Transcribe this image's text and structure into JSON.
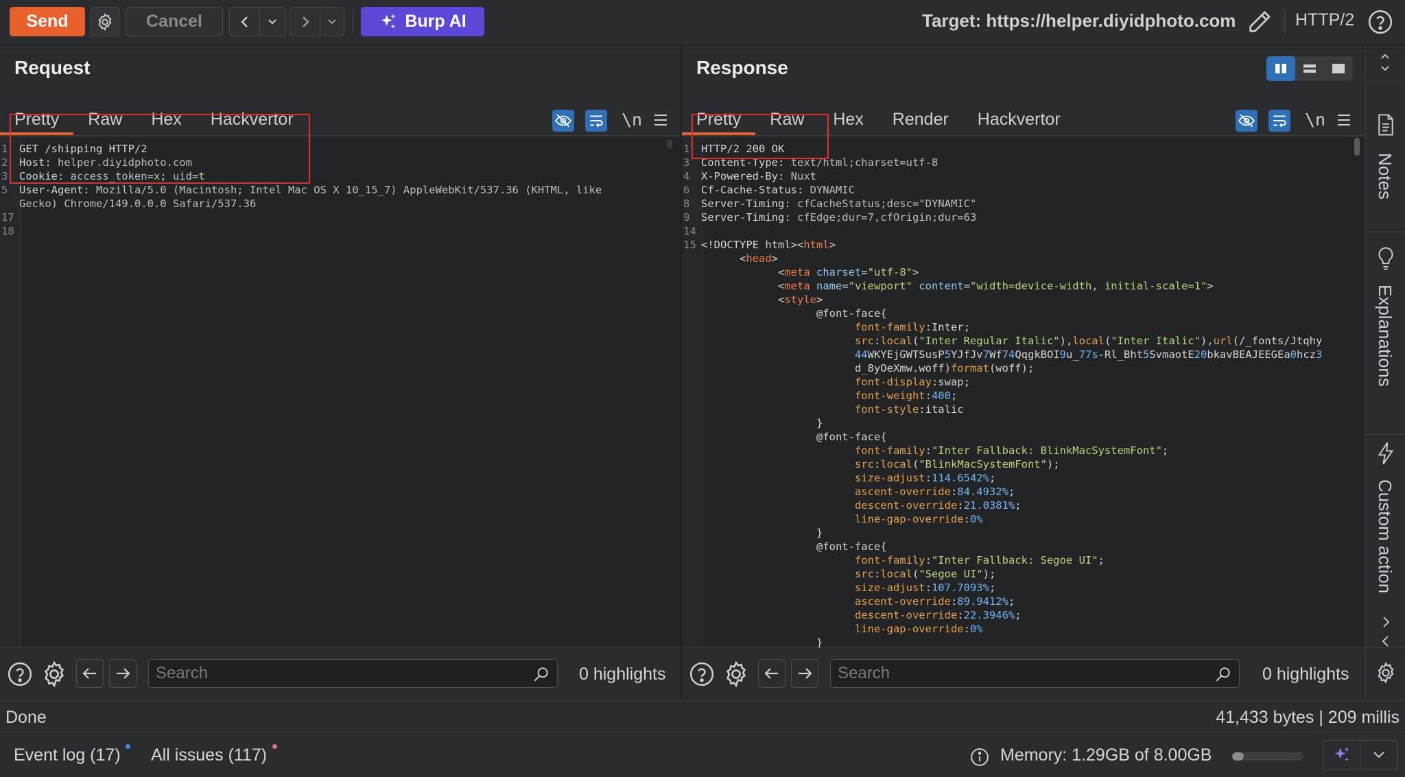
{
  "toolbar": {
    "send_label": "Send",
    "cancel_label": "Cancel",
    "burp_ai_label": "Burp AI",
    "target_label": "Target: https://helper.diyidphoto.com",
    "protocol_label": "HTTP/2"
  },
  "request": {
    "title": "Request",
    "tabs": [
      "Pretty",
      "Raw",
      "Hex",
      "Hackvertor"
    ],
    "newline_toggle": "\\n",
    "lines": [
      {
        "n": "1",
        "parts": [
          [
            "h",
            "GET /shipping HTTP/2"
          ]
        ]
      },
      {
        "n": "2",
        "parts": [
          [
            "h",
            "Host: "
          ],
          [
            "v",
            "helper.diyidphoto.com"
          ]
        ]
      },
      {
        "n": "3",
        "parts": [
          [
            "h",
            "Cookie: "
          ],
          [
            "v",
            "access_token"
          ],
          [
            "h",
            "="
          ],
          [
            "s",
            "x"
          ],
          [
            "h",
            "; "
          ],
          [
            "v",
            "uid"
          ],
          [
            "h",
            "="
          ],
          [
            "s",
            "t"
          ]
        ]
      },
      {
        "n": "5",
        "parts": [
          [
            "h",
            "User-Agent: "
          ],
          [
            "v",
            "Mozilla/5.0 (Macintosh; Intel Mac OS X 10_15_7) AppleWebKit/537.36 (KHTML, like"
          ]
        ]
      },
      {
        "n": "",
        "parts": [
          [
            "v",
            "Gecko) Chrome/149.0.0.0 Safari/537.36"
          ]
        ]
      },
      {
        "n": "17",
        "parts": []
      },
      {
        "n": "18",
        "parts": []
      }
    ],
    "search_placeholder": "Search",
    "highlights": "0 highlights"
  },
  "response": {
    "title": "Response",
    "tabs": [
      "Pretty",
      "Raw",
      "Hex",
      "Render",
      "Hackvertor"
    ],
    "newline_toggle": "\\n",
    "lines": [
      {
        "n": "1",
        "parts": [
          [
            "h",
            "HTTP/2 200 OK"
          ]
        ]
      },
      {
        "n": "3",
        "parts": [
          [
            "h",
            "Content-Type: "
          ],
          [
            "v",
            "text/html;charset=utf-8"
          ]
        ]
      },
      {
        "n": "4",
        "parts": [
          [
            "h",
            "X-Powered-By: "
          ],
          [
            "v",
            "Nuxt"
          ]
        ]
      },
      {
        "n": "6",
        "parts": [
          [
            "h",
            "Cf-Cache-Status: "
          ],
          [
            "v",
            "DYNAMIC"
          ]
        ]
      },
      {
        "n": "8",
        "parts": [
          [
            "h",
            "Server-Timing: "
          ],
          [
            "v",
            "cfCacheStatus;desc=\"DYNAMIC\""
          ]
        ]
      },
      {
        "n": "9",
        "parts": [
          [
            "h",
            "Server-Timing: "
          ],
          [
            "v",
            "cfEdge;dur=7,cfOrigin;dur=63"
          ]
        ]
      },
      {
        "n": "14",
        "parts": []
      },
      {
        "n": "15",
        "parts": [
          [
            "k",
            "<!DOCTYPE html>"
          ],
          [
            "k",
            "<"
          ],
          [
            "t",
            "html"
          ],
          [
            "k",
            ">"
          ]
        ]
      },
      {
        "n": "",
        "parts": [
          [
            "k",
            "      <"
          ],
          [
            "t",
            "head"
          ],
          [
            "k",
            ">"
          ]
        ]
      },
      {
        "n": "",
        "parts": [
          [
            "k",
            "            <"
          ],
          [
            "t",
            "meta"
          ],
          [
            "a",
            " charset"
          ],
          [
            "k",
            "="
          ],
          [
            "s",
            "\"utf-8\""
          ],
          [
            "k",
            ">"
          ]
        ]
      },
      {
        "n": "",
        "parts": [
          [
            "k",
            "            <"
          ],
          [
            "t",
            "meta"
          ],
          [
            "a",
            " name"
          ],
          [
            "k",
            "="
          ],
          [
            "s",
            "\"viewport\""
          ],
          [
            "a",
            " content"
          ],
          [
            "k",
            "="
          ],
          [
            "s",
            "\"width=device-width, initial-scale=1\""
          ],
          [
            "k",
            ">"
          ]
        ]
      },
      {
        "n": "",
        "parts": [
          [
            "k",
            "            <"
          ],
          [
            "t",
            "style"
          ],
          [
            "k",
            ">"
          ]
        ]
      },
      {
        "n": "",
        "parts": [
          [
            "k",
            "                  @font-face{"
          ]
        ]
      },
      {
        "n": "",
        "parts": [
          [
            "p",
            "                        font-family"
          ],
          [
            "k",
            ":Inter;"
          ]
        ]
      },
      {
        "n": "",
        "parts": [
          [
            "p",
            "                        src"
          ],
          [
            "k",
            ":"
          ],
          [
            "p",
            "local"
          ],
          [
            "k",
            "("
          ],
          [
            "s",
            "\"Inter Regular Italic\""
          ],
          [
            "k",
            "),"
          ],
          [
            "p",
            "local"
          ],
          [
            "k",
            "("
          ],
          [
            "s",
            "\"Inter Italic\""
          ],
          [
            "k",
            "),"
          ],
          [
            "p",
            "url"
          ],
          [
            "k",
            "(/_fonts/Jtqhy"
          ]
        ]
      },
      {
        "n": "",
        "parts": [
          [
            "n",
            "                        44"
          ],
          [
            "k",
            "WKYEjGWTSusP"
          ],
          [
            "n",
            "5"
          ],
          [
            "k",
            "YJfJv"
          ],
          [
            "n",
            "7"
          ],
          [
            "k",
            "Wf"
          ],
          [
            "n",
            "74"
          ],
          [
            "k",
            "QqgkBOI"
          ],
          [
            "n",
            "9"
          ],
          [
            "k",
            "u_"
          ],
          [
            "n",
            "77s"
          ],
          [
            "k",
            "-Rl_Bht"
          ],
          [
            "n",
            "5"
          ],
          [
            "k",
            "SvmaotE"
          ],
          [
            "n",
            "20"
          ],
          [
            "k",
            "bkavBEAJEEGEa"
          ],
          [
            "n",
            "0"
          ],
          [
            "k",
            "hcz"
          ],
          [
            "n",
            "3"
          ]
        ]
      },
      {
        "n": "",
        "parts": [
          [
            "k",
            "                        d_8yOeXmw.woff)"
          ],
          [
            "p",
            "format"
          ],
          [
            "k",
            "(woff);"
          ]
        ]
      },
      {
        "n": "",
        "parts": [
          [
            "p",
            "                        font-display"
          ],
          [
            "k",
            ":swap;"
          ]
        ]
      },
      {
        "n": "",
        "parts": [
          [
            "p",
            "                        font-weight"
          ],
          [
            "k",
            ":"
          ],
          [
            "n",
            "400"
          ],
          [
            "k",
            ";"
          ]
        ]
      },
      {
        "n": "",
        "parts": [
          [
            "p",
            "                        font-style"
          ],
          [
            "k",
            ":italic"
          ]
        ]
      },
      {
        "n": "",
        "parts": [
          [
            "k",
            "                  }"
          ]
        ]
      },
      {
        "n": "",
        "parts": [
          [
            "k",
            "                  @font-face{"
          ]
        ]
      },
      {
        "n": "",
        "parts": [
          [
            "p",
            "                        font-family"
          ],
          [
            "k",
            ":"
          ],
          [
            "s",
            "\"Inter Fallback: BlinkMacSystemFont\""
          ],
          [
            "k",
            ";"
          ]
        ]
      },
      {
        "n": "",
        "parts": [
          [
            "p",
            "                        src"
          ],
          [
            "k",
            ":"
          ],
          [
            "p",
            "local"
          ],
          [
            "k",
            "("
          ],
          [
            "s",
            "\"BlinkMacSystemFont\""
          ],
          [
            "k",
            ");"
          ]
        ]
      },
      {
        "n": "",
        "parts": [
          [
            "p",
            "                        size-adjust"
          ],
          [
            "k",
            ":"
          ],
          [
            "n",
            "114.6542%"
          ],
          [
            "k",
            ";"
          ]
        ]
      },
      {
        "n": "",
        "parts": [
          [
            "p",
            "                        ascent-override"
          ],
          [
            "k",
            ":"
          ],
          [
            "n",
            "84.4932%"
          ],
          [
            "k",
            ";"
          ]
        ]
      },
      {
        "n": "",
        "parts": [
          [
            "p",
            "                        descent-override"
          ],
          [
            "k",
            ":"
          ],
          [
            "n",
            "21.0381%"
          ],
          [
            "k",
            ";"
          ]
        ]
      },
      {
        "n": "",
        "parts": [
          [
            "p",
            "                        line-gap-override"
          ],
          [
            "k",
            ":"
          ],
          [
            "n",
            "0%"
          ]
        ]
      },
      {
        "n": "",
        "parts": [
          [
            "k",
            "                  }"
          ]
        ]
      },
      {
        "n": "",
        "parts": [
          [
            "k",
            "                  @font-face{"
          ]
        ]
      },
      {
        "n": "",
        "parts": [
          [
            "p",
            "                        font-family"
          ],
          [
            "k",
            ":"
          ],
          [
            "s",
            "\"Inter Fallback: Segoe UI\""
          ],
          [
            "k",
            ";"
          ]
        ]
      },
      {
        "n": "",
        "parts": [
          [
            "p",
            "                        src"
          ],
          [
            "k",
            ":"
          ],
          [
            "p",
            "local"
          ],
          [
            "k",
            "("
          ],
          [
            "s",
            "\"Segoe UI\""
          ],
          [
            "k",
            ");"
          ]
        ]
      },
      {
        "n": "",
        "parts": [
          [
            "p",
            "                        size-adjust"
          ],
          [
            "k",
            ":"
          ],
          [
            "n",
            "107.7093%"
          ],
          [
            "k",
            ";"
          ]
        ]
      },
      {
        "n": "",
        "parts": [
          [
            "p",
            "                        ascent-override"
          ],
          [
            "k",
            ":"
          ],
          [
            "n",
            "89.9412%"
          ],
          [
            "k",
            ";"
          ]
        ]
      },
      {
        "n": "",
        "parts": [
          [
            "p",
            "                        descent-override"
          ],
          [
            "k",
            ":"
          ],
          [
            "n",
            "22.3946%"
          ],
          [
            "k",
            ";"
          ]
        ]
      },
      {
        "n": "",
        "parts": [
          [
            "p",
            "                        line-gap-override"
          ],
          [
            "k",
            ":"
          ],
          [
            "n",
            "0%"
          ]
        ]
      },
      {
        "n": "",
        "parts": [
          [
            "k",
            "                  }"
          ]
        ]
      }
    ],
    "search_placeholder": "Search",
    "highlights": "0 highlights"
  },
  "right_rail": {
    "notes_label": "Notes",
    "explanations_label": "Explanations",
    "custom_actions_label": "Custom action"
  },
  "status": {
    "state": "Done",
    "size_time": "41,433 bytes | 209 millis"
  },
  "bottom": {
    "event_log": "Event log (17)",
    "all_issues": "All issues (117)",
    "memory": "Memory: 1.29GB of 8.00GB",
    "memory_fraction": 0.16
  },
  "colors": {
    "send": "#e8602c",
    "burp_ai": "#5b48d6",
    "active_tab": "#e8602c",
    "highlight_box": "#e0312a",
    "toggle_blue": "#2e6fb6"
  }
}
